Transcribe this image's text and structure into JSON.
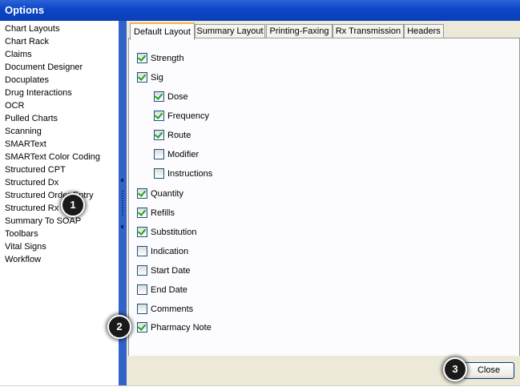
{
  "window": {
    "title": "Options"
  },
  "sidebar": {
    "items": [
      {
        "label": "Chart Layouts"
      },
      {
        "label": "Chart Rack"
      },
      {
        "label": "Claims"
      },
      {
        "label": "Document Designer"
      },
      {
        "label": "Docuplates"
      },
      {
        "label": "Drug Interactions"
      },
      {
        "label": "OCR"
      },
      {
        "label": "Pulled Charts"
      },
      {
        "label": "Scanning"
      },
      {
        "label": "SMARText"
      },
      {
        "label": "SMARText Color Coding"
      },
      {
        "label": "Structured CPT"
      },
      {
        "label": "Structured Dx"
      },
      {
        "label": "Structured Order Entry"
      },
      {
        "label": "Structured Rx"
      },
      {
        "label": "Summary To SOAP"
      },
      {
        "label": "Toolbars"
      },
      {
        "label": "Vital Signs"
      },
      {
        "label": "Workflow"
      }
    ],
    "selected": "Structured Rx"
  },
  "tabs": [
    {
      "label": "Default Layout",
      "active": true
    },
    {
      "label": "Summary Layout",
      "active": false
    },
    {
      "label": "Printing-Faxing",
      "active": false
    },
    {
      "label": "Rx Transmission",
      "active": false
    },
    {
      "label": "Headers",
      "active": false
    }
  ],
  "fields": [
    {
      "label": "Strength",
      "checked": true
    },
    {
      "label": "Sig",
      "checked": true
    },
    {
      "label": "Dose",
      "checked": true
    },
    {
      "label": "Frequency",
      "checked": true
    },
    {
      "label": "Route",
      "checked": true
    },
    {
      "label": "Modifier",
      "checked": false
    },
    {
      "label": "Instructions",
      "checked": false
    },
    {
      "label": "Quantity",
      "checked": true
    },
    {
      "label": "Refills",
      "checked": true
    },
    {
      "label": "Substitution",
      "checked": true
    },
    {
      "label": "Indication",
      "checked": false
    },
    {
      "label": "Start Date",
      "checked": false
    },
    {
      "label": "End Date",
      "checked": false
    },
    {
      "label": "Comments",
      "checked": false
    },
    {
      "label": "Pharmacy Note",
      "checked": true
    }
  ],
  "footer": {
    "close_label": "Close"
  },
  "callouts": [
    {
      "number": "1"
    },
    {
      "number": "2"
    },
    {
      "number": "3"
    }
  ],
  "colors": {
    "titlebar": "#0b46c7",
    "splitter": "#3163c9",
    "panel": "#ece9d8",
    "check": "#21a121",
    "active_tab_accent": "#f7b44a"
  }
}
